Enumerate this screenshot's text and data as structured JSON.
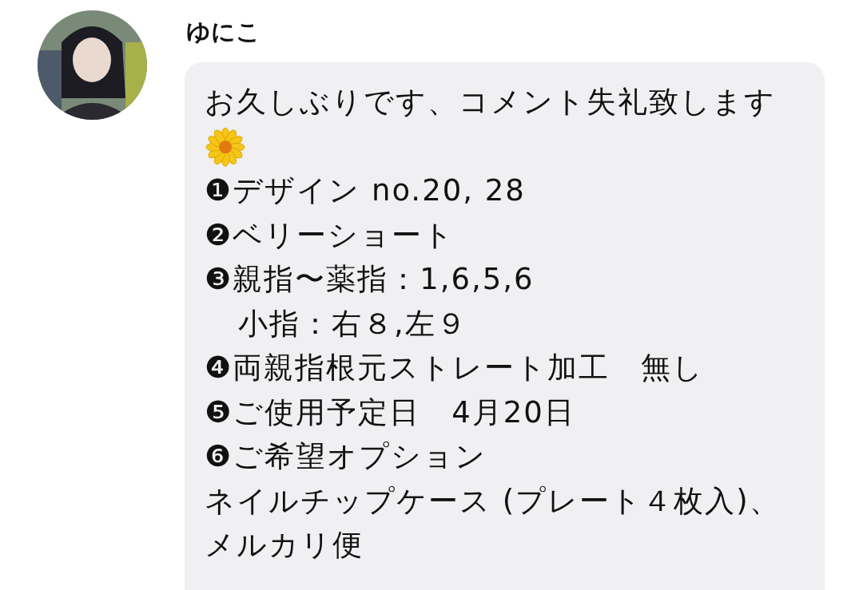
{
  "comment": {
    "author": "ゆにこ",
    "lines": [
      {
        "kind": "text",
        "text": "お久しぶりです、コメント失礼致します"
      },
      {
        "kind": "flower"
      },
      {
        "kind": "text",
        "text": "❶デザイン no.20, 28"
      },
      {
        "kind": "text",
        "text": "❷ベリーショート"
      },
      {
        "kind": "text",
        "text": "❸親指〜薬指：1,6,5,6"
      },
      {
        "kind": "indent",
        "text": "小指：右８,左９"
      },
      {
        "kind": "text",
        "text": "❹両親指根元ストレート加工　無し"
      },
      {
        "kind": "text",
        "text": "❺ご使用予定日　4月20日"
      },
      {
        "kind": "text",
        "text": "❻ご希望オプション"
      },
      {
        "kind": "text",
        "text": "ネイルチップケース (プレート４枚入)、"
      },
      {
        "kind": "text",
        "text": "メルカリ便"
      }
    ]
  }
}
